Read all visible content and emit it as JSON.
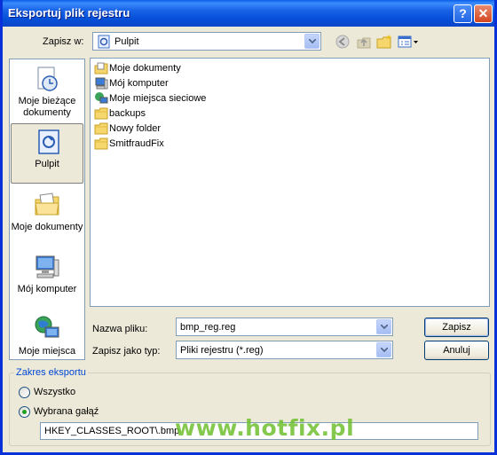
{
  "window": {
    "title": "Eksportuj plik rejestru",
    "help_glyph": "?",
    "close_glyph": "✕"
  },
  "toolbar": {
    "save_in_label": "Zapisz w:",
    "save_in_value": "Pulpit",
    "icons": [
      "back-icon",
      "up-folder-icon",
      "new-folder-icon",
      "view-menu-icon"
    ]
  },
  "places": [
    {
      "label": "Moje bieżące dokumenty",
      "icon": "recent-documents-icon"
    },
    {
      "label": "Pulpit",
      "icon": "desktop-icon",
      "selected": true
    },
    {
      "label": "Moje dokumenty",
      "icon": "my-documents-icon"
    },
    {
      "label": "Mój komputer",
      "icon": "my-computer-icon"
    },
    {
      "label": "Moje miejsca",
      "icon": "network-places-icon"
    }
  ],
  "files": [
    {
      "name": "Moje dokumenty",
      "icon": "my-documents-icon"
    },
    {
      "name": "Mój komputer",
      "icon": "my-computer-icon"
    },
    {
      "name": "Moje miejsca sieciowe",
      "icon": "network-places-icon"
    },
    {
      "name": "backups",
      "icon": "folder-icon"
    },
    {
      "name": "Nowy folder",
      "icon": "folder-icon"
    },
    {
      "name": "SmitfraudFix",
      "icon": "folder-icon"
    }
  ],
  "form": {
    "filename_label": "Nazwa pliku:",
    "filename_value": "bmp_reg.reg",
    "filetype_label": "Zapisz jako typ:",
    "filetype_value": "Pliki rejestru (*.reg)",
    "save_button": "Zapisz",
    "cancel_button": "Anuluj"
  },
  "export_range": {
    "title": "Zakres eksportu",
    "option_all": "Wszystko",
    "option_branch": "Wybrana gałąź",
    "selected": "branch",
    "branch_value": "HKEY_CLASSES_ROOT\\.bmp"
  },
  "watermark": "www.hotfix.pl",
  "colors": {
    "titlebar": "#0a5ee6",
    "dialog_bg": "#ece9d8",
    "accent_group_title": "#0046d5",
    "watermark": "#6fbf2e"
  }
}
